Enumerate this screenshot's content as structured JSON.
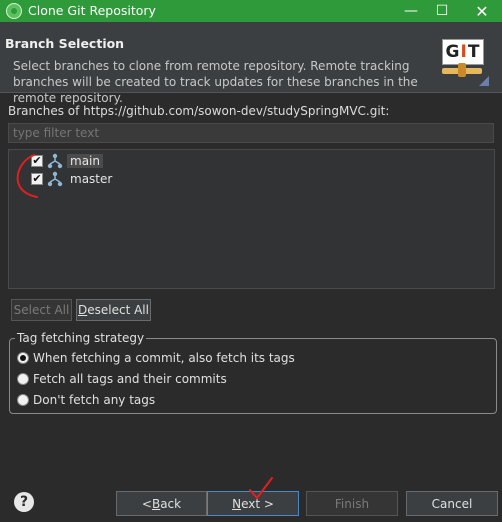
{
  "window": {
    "title": "Clone Git Repository",
    "minimize": "—",
    "maximize": "☐",
    "close": "✕"
  },
  "header": {
    "title": "Branch Selection",
    "description": "Select branches to clone from remote repository. Remote tracking branches will be created to track updates for these branches in the remote repository.",
    "logo_text_g": "G",
    "logo_text_i": "I",
    "logo_text_t": "T"
  },
  "branches": {
    "label": "Branches of https://github.com/sowon-dev/studySpringMVC.git:",
    "filter_placeholder": "type filter text",
    "items": [
      {
        "name": "main",
        "checked": true,
        "selected": true
      },
      {
        "name": "master",
        "checked": true,
        "selected": false
      }
    ],
    "select_all": "Select All",
    "deselect_all_first": "D",
    "deselect_all_rest": "eselect All"
  },
  "tag_strategy": {
    "title": "Tag fetching strategy",
    "options": [
      {
        "label": "When fetching a commit, also fetch its tags",
        "selected": true
      },
      {
        "label": "Fetch all tags and their commits",
        "selected": false
      },
      {
        "label": "Don't fetch any tags",
        "selected": false
      }
    ]
  },
  "footer": {
    "help": "?",
    "back_prefix": "< ",
    "back_mnemonic": "B",
    "back_rest": "ack",
    "next_mnemonic": "N",
    "next_rest": "ext >",
    "finish": "Finish",
    "cancel": "Cancel"
  },
  "colors": {
    "titlebar": "#2f9a3a",
    "annotation": "#e02020"
  }
}
